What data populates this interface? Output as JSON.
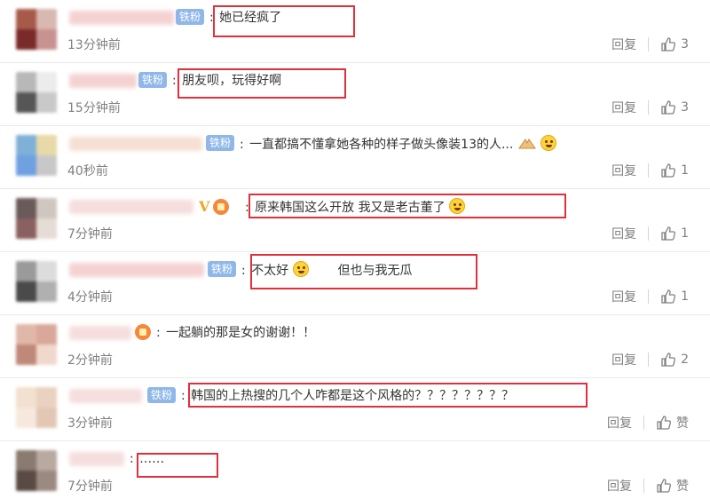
{
  "fan_badge_label": "铁粉",
  "vip_mark": "V",
  "comments": [
    {
      "text": "她已经疯了",
      "time": "13分钟前",
      "reply": "回复",
      "likes": "3"
    },
    {
      "text": "朋友呗，玩得好啊",
      "time": "15分钟前",
      "reply": "回复",
      "likes": "3"
    },
    {
      "text": "一直都搞不懂拿她各种的样子做头像装13的人...",
      "time": "40秒前",
      "reply": "回复",
      "likes": "1"
    },
    {
      "text": "原来韩国这么开放  我又是老古董了",
      "time": "7分钟前",
      "reply": "回复",
      "likes": "1"
    },
    {
      "text_before": "不太好",
      "text_after": "但也与我无瓜",
      "time": "4分钟前",
      "reply": "回复",
      "likes": "1"
    },
    {
      "text": "一起躺的那是女的谢谢！！",
      "time": "2分钟前",
      "reply": "回复",
      "likes": "2"
    },
    {
      "text": "韩国的上热搜的几个人咋都是这个风格的？？？？？？？？",
      "time": "3分钟前",
      "reply": "回复",
      "likes": "赞"
    },
    {
      "text": "……",
      "time": "7分钟前",
      "reply": "回复",
      "likes": "赞"
    }
  ],
  "colors": {
    "highlight_border": "#e0303b",
    "fan_badge_bg": "#8fb7e8",
    "vip_gold": "#f2a51a",
    "meta_gray": "#808080"
  }
}
